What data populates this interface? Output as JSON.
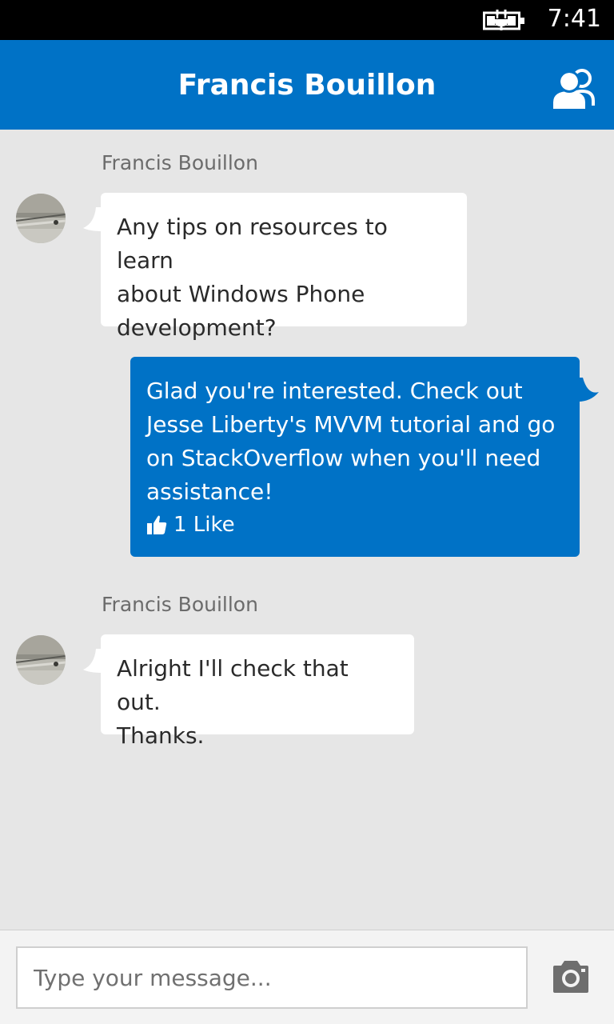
{
  "status_bar": {
    "time": "7:41",
    "battery_icon": "battery-charging-icon"
  },
  "header": {
    "title": "Francis Bouillon",
    "people_icon": "people-icon"
  },
  "messages": [
    {
      "direction": "incoming",
      "sender": "Francis Bouillon",
      "lines": [
        "Any tips on resources to learn",
        "about Windows Phone",
        "development?"
      ]
    },
    {
      "direction": "outgoing",
      "lines": [
        "Glad you're interested. Check out",
        "Jesse Liberty's MVVM tutorial and go",
        "on StackOverflow when you'll need",
        "assistance!"
      ],
      "likes": "1 Like"
    },
    {
      "direction": "incoming",
      "sender": "Francis Bouillon",
      "lines": [
        "Alright I'll check that out.",
        "Thanks."
      ]
    }
  ],
  "composer": {
    "placeholder": "Type your message...",
    "value": "",
    "camera_icon": "camera-icon"
  },
  "colors": {
    "accent": "#0072c6",
    "background": "#e6e6e6",
    "status_bar": "#000000"
  }
}
